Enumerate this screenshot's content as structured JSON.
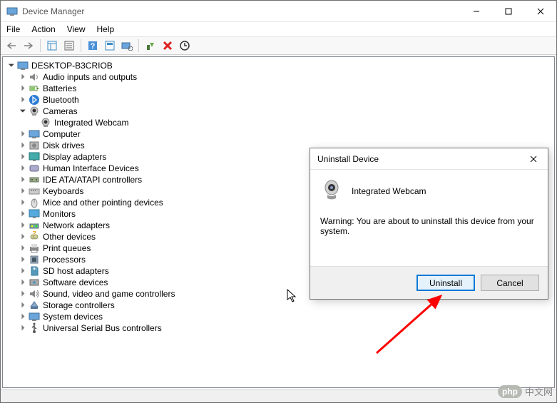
{
  "window": {
    "title": "Device Manager"
  },
  "menubar": [
    "File",
    "Action",
    "View",
    "Help"
  ],
  "tree": {
    "root": "DESKTOP-B3CRIOB",
    "items": [
      {
        "label": "Audio inputs and outputs",
        "icon": "speaker"
      },
      {
        "label": "Batteries",
        "icon": "battery"
      },
      {
        "label": "Bluetooth",
        "icon": "bluetooth"
      },
      {
        "label": "Cameras",
        "icon": "camera",
        "open": true,
        "children": [
          {
            "label": "Integrated Webcam",
            "icon": "camera"
          }
        ]
      },
      {
        "label": "Computer",
        "icon": "computer"
      },
      {
        "label": "Disk drives",
        "icon": "disk"
      },
      {
        "label": "Display adapters",
        "icon": "display"
      },
      {
        "label": "Human Interface Devices",
        "icon": "hid"
      },
      {
        "label": "IDE ATA/ATAPI controllers",
        "icon": "ide"
      },
      {
        "label": "Keyboards",
        "icon": "keyboard"
      },
      {
        "label": "Mice and other pointing devices",
        "icon": "mouse"
      },
      {
        "label": "Monitors",
        "icon": "monitor"
      },
      {
        "label": "Network adapters",
        "icon": "network"
      },
      {
        "label": "Other devices",
        "icon": "other"
      },
      {
        "label": "Print queues",
        "icon": "printer"
      },
      {
        "label": "Processors",
        "icon": "cpu"
      },
      {
        "label": "SD host adapters",
        "icon": "sd"
      },
      {
        "label": "Software devices",
        "icon": "software"
      },
      {
        "label": "Sound, video and game controllers",
        "icon": "sound"
      },
      {
        "label": "Storage controllers",
        "icon": "storage"
      },
      {
        "label": "System devices",
        "icon": "system"
      },
      {
        "label": "Universal Serial Bus controllers",
        "icon": "usb"
      }
    ]
  },
  "dialog": {
    "title": "Uninstall Device",
    "device": "Integrated Webcam",
    "warning": "Warning: You are about to uninstall this device from your system.",
    "primary": "Uninstall",
    "secondary": "Cancel"
  },
  "watermark": {
    "logo": "php",
    "text": "中文网"
  }
}
